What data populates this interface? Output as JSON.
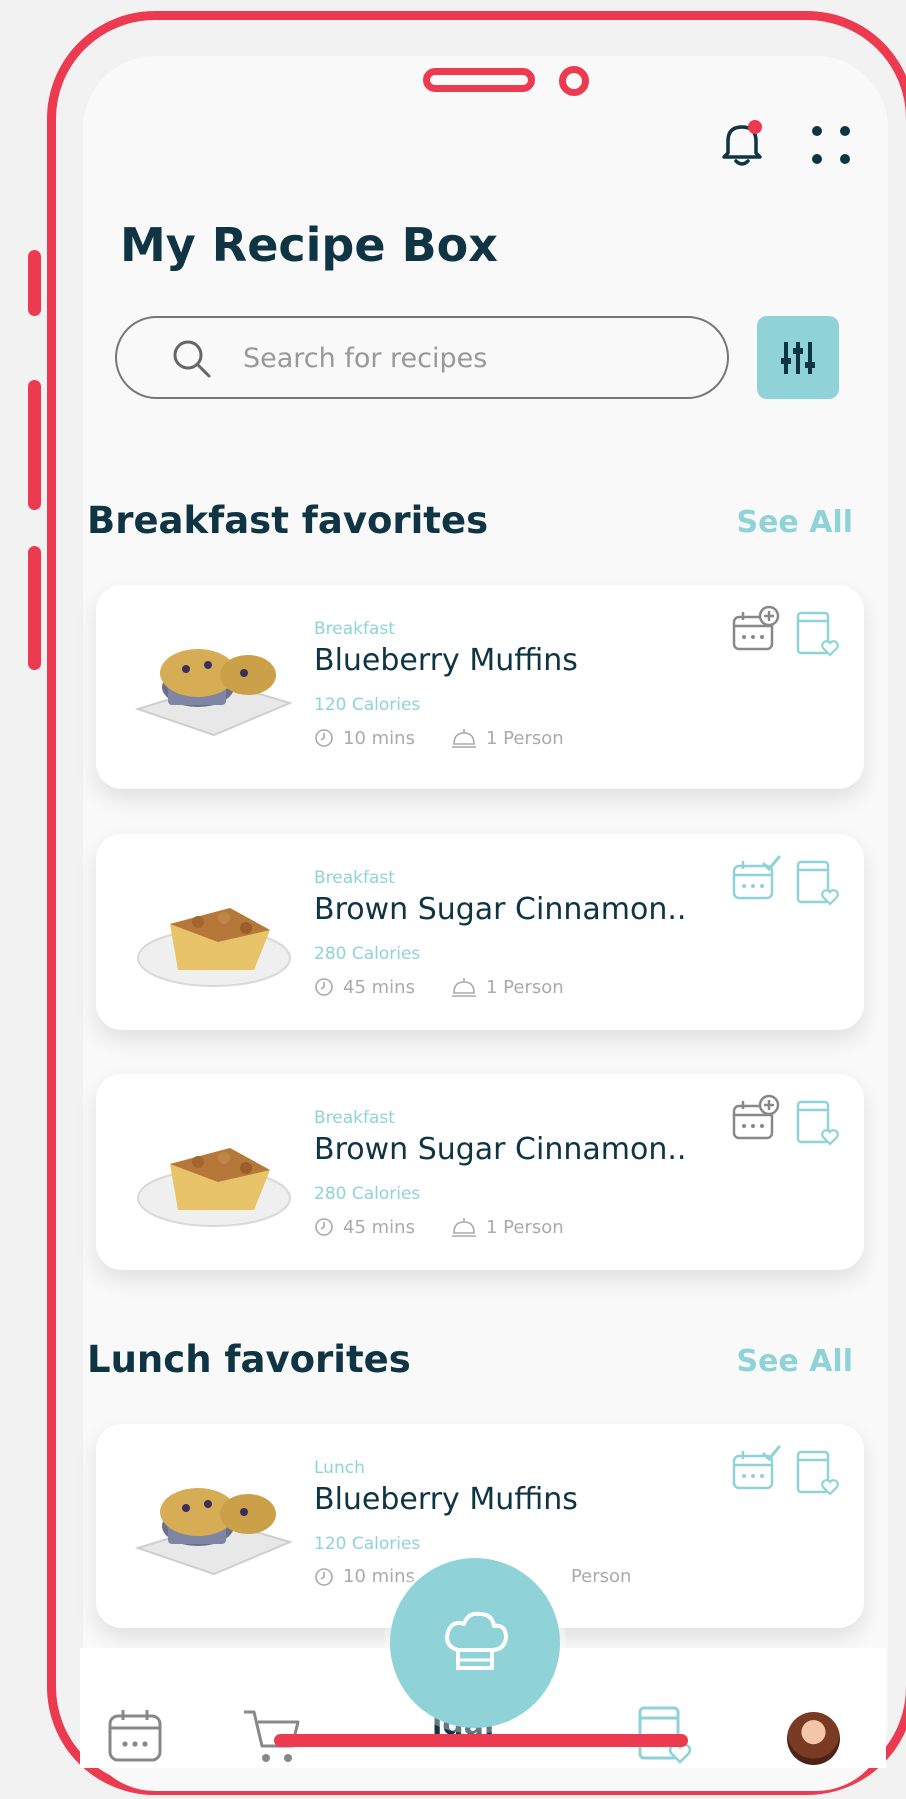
{
  "header": {
    "title": "My Recipe Box"
  },
  "search": {
    "placeholder": "Search for recipes"
  },
  "sections": [
    {
      "title": "Breakfast favorites",
      "see_all": "See All",
      "cards": [
        {
          "category": "Breakfast",
          "name": "Blueberry Muffins",
          "calories": "120 Calories",
          "time": "10 mins",
          "servings": "1 Person",
          "planned": false,
          "image": "blueberry-muffins"
        },
        {
          "category": "Breakfast",
          "name": "Brown Sugar Cinnamon..",
          "calories": "280 Calories",
          "time": "45 mins",
          "servings": "1 Person",
          "planned": true,
          "image": "coffee-cake"
        },
        {
          "category": "Breakfast",
          "name": "Brown Sugar Cinnamon..",
          "calories": "280 Calories",
          "time": "45 mins",
          "servings": "1 Person",
          "planned": false,
          "image": "coffee-cake"
        }
      ]
    },
    {
      "title": "Lunch favorites",
      "see_all": "See All",
      "cards": [
        {
          "category": "Lunch",
          "name": "Blueberry Muffins",
          "calories": "120 Calories",
          "time": "10 mins",
          "servings": "Person",
          "planned": true,
          "image": "blueberry-muffins"
        }
      ]
    }
  ],
  "bottom_nav": {
    "label_partial": "ldar"
  },
  "colors": {
    "accent": "#8fd3d8",
    "frame": "#ec3a50",
    "heading": "#0f3443",
    "notification_dot": "#ec3a50"
  },
  "icons": [
    "bell-icon",
    "grid-icon",
    "search-icon",
    "sliders-icon",
    "calendar-add-icon",
    "calendar-check-icon",
    "recipe-book-heart-icon",
    "clock-icon",
    "serving-dish-icon",
    "chef-hat-icon",
    "calendar-icon",
    "cart-icon",
    "avatar"
  ]
}
